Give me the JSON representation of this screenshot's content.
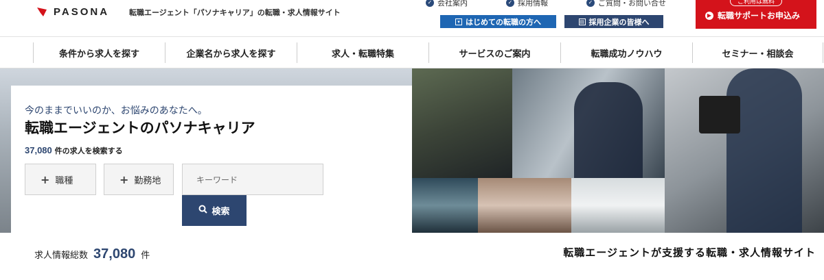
{
  "header": {
    "logo_text": "PASONA",
    "tagline": "転職エージェント「パソナキャリア」の転職・求人情報サイト",
    "top_links": [
      "会社案内",
      "採用情報",
      "ご質問・お問い合せ"
    ],
    "first_time_label": "はじめての転職の方へ",
    "corporate_label": "採用企業の皆様へ",
    "cta_top_label": "ご利用は無料",
    "cta_label": "転職サポートお申込み"
  },
  "nav": {
    "items": [
      "条件から求人を探す",
      "企業名から求人を探す",
      "求人・転職特集",
      "サービスのご案内",
      "転職成功ノウハウ",
      "セミナー・相談会"
    ]
  },
  "hero": {
    "lead": "今のままでいいのか、お悩みのあなたへ。",
    "title": "転職エージェントのパソナキャリア",
    "count": "37,080",
    "count_suffix": "件の求人を検索する",
    "job_type_label": "職種",
    "location_label": "勤務地",
    "keyword_placeholder": "キーワード",
    "search_label": "検索"
  },
  "summary": {
    "total_label": "求人情報総数",
    "total_count": "37,080",
    "total_unit": "件",
    "support_text": "転職エージェントが支援する転職・求人情報サイト"
  },
  "colors": {
    "navy": "#2d4670",
    "blue": "#1e66b3",
    "red": "#d4131b"
  }
}
